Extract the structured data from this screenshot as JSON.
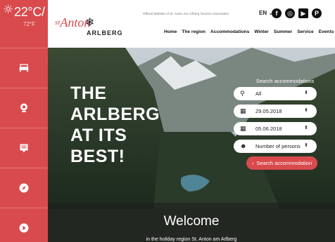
{
  "weather": {
    "temperature": "22°C",
    "separator": "/",
    "secondary": "72°F",
    "icon": "sun-cloud-icon"
  },
  "sidebar": {
    "items": [
      {
        "name": "accommodation",
        "icon": "bed-icon"
      },
      {
        "name": "webcams",
        "icon": "webcam-icon"
      },
      {
        "name": "brochures",
        "icon": "brochure-icon"
      },
      {
        "name": "map",
        "icon": "compass-icon"
      },
      {
        "name": "video",
        "icon": "play-icon"
      }
    ]
  },
  "header": {
    "logo_prefix": "st",
    "logo_main": "Anton",
    "logo_subtitle": "ARLBERG",
    "official_text": "Official Website of St. Anton am Arlberg Tourism Association",
    "language": "EN",
    "language_caret": "⌄",
    "social": [
      {
        "name": "facebook-icon",
        "glyph": "f"
      },
      {
        "name": "globe-icon",
        "glyph": "◎"
      },
      {
        "name": "youtube-icon",
        "glyph": "▶"
      },
      {
        "name": "pinterest-icon",
        "glyph": "P"
      }
    ],
    "nav": [
      "Home",
      "The region",
      "Accommodations",
      "Winter",
      "Summer",
      "Service",
      "Events"
    ]
  },
  "hero": {
    "headline_lines": [
      "THE",
      "ARLBERG",
      "AT ITS",
      "BEST!"
    ],
    "search_title": "Search accommodations",
    "fields": [
      {
        "icon": "location-pin-icon",
        "value": "All"
      },
      {
        "icon": "calendar-icon",
        "value": "29.05.2018"
      },
      {
        "icon": "calendar-icon",
        "value": "05.06.2018"
      },
      {
        "icon": "persons-icon",
        "value": "Number of persons"
      }
    ],
    "search_button": "Search accommodation",
    "welcome_title": "Welcome",
    "welcome_subtitle": "in the holiday region St. Anton am Arlberg"
  },
  "colors": {
    "accent": "#d94a4d",
    "rail": "#d94a4d",
    "text_dark": "#111111",
    "white": "#ffffff"
  }
}
